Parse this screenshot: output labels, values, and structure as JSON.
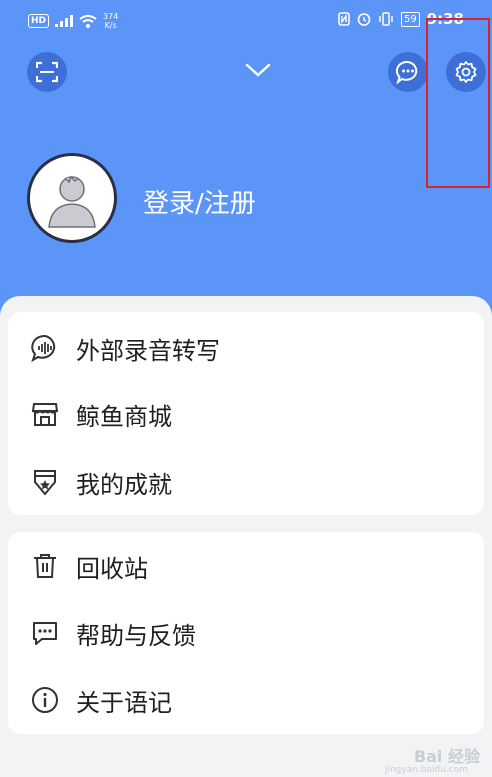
{
  "statusbar": {
    "hd": "HD",
    "speed_value": "374",
    "speed_unit": "K/s",
    "battery": "59",
    "time": "9:38"
  },
  "profile": {
    "login_text": "登录/注册"
  },
  "menu_group1": [
    {
      "label": "外部录音转写",
      "icon": "sound-wave-bubble-icon"
    },
    {
      "label": "鲸鱼商城",
      "icon": "store-icon"
    },
    {
      "label": "我的成就",
      "icon": "medal-icon"
    }
  ],
  "menu_group2": [
    {
      "label": "回收站",
      "icon": "trash-icon"
    },
    {
      "label": "帮助与反馈",
      "icon": "feedback-icon"
    },
    {
      "label": "关于语记",
      "icon": "info-icon"
    }
  ],
  "watermark": {
    "text": "Bai 经验",
    "sub": "jingyan.baidu.com"
  },
  "colors": {
    "header_bg": "#5b95f8",
    "highlight": "#d6232e"
  }
}
